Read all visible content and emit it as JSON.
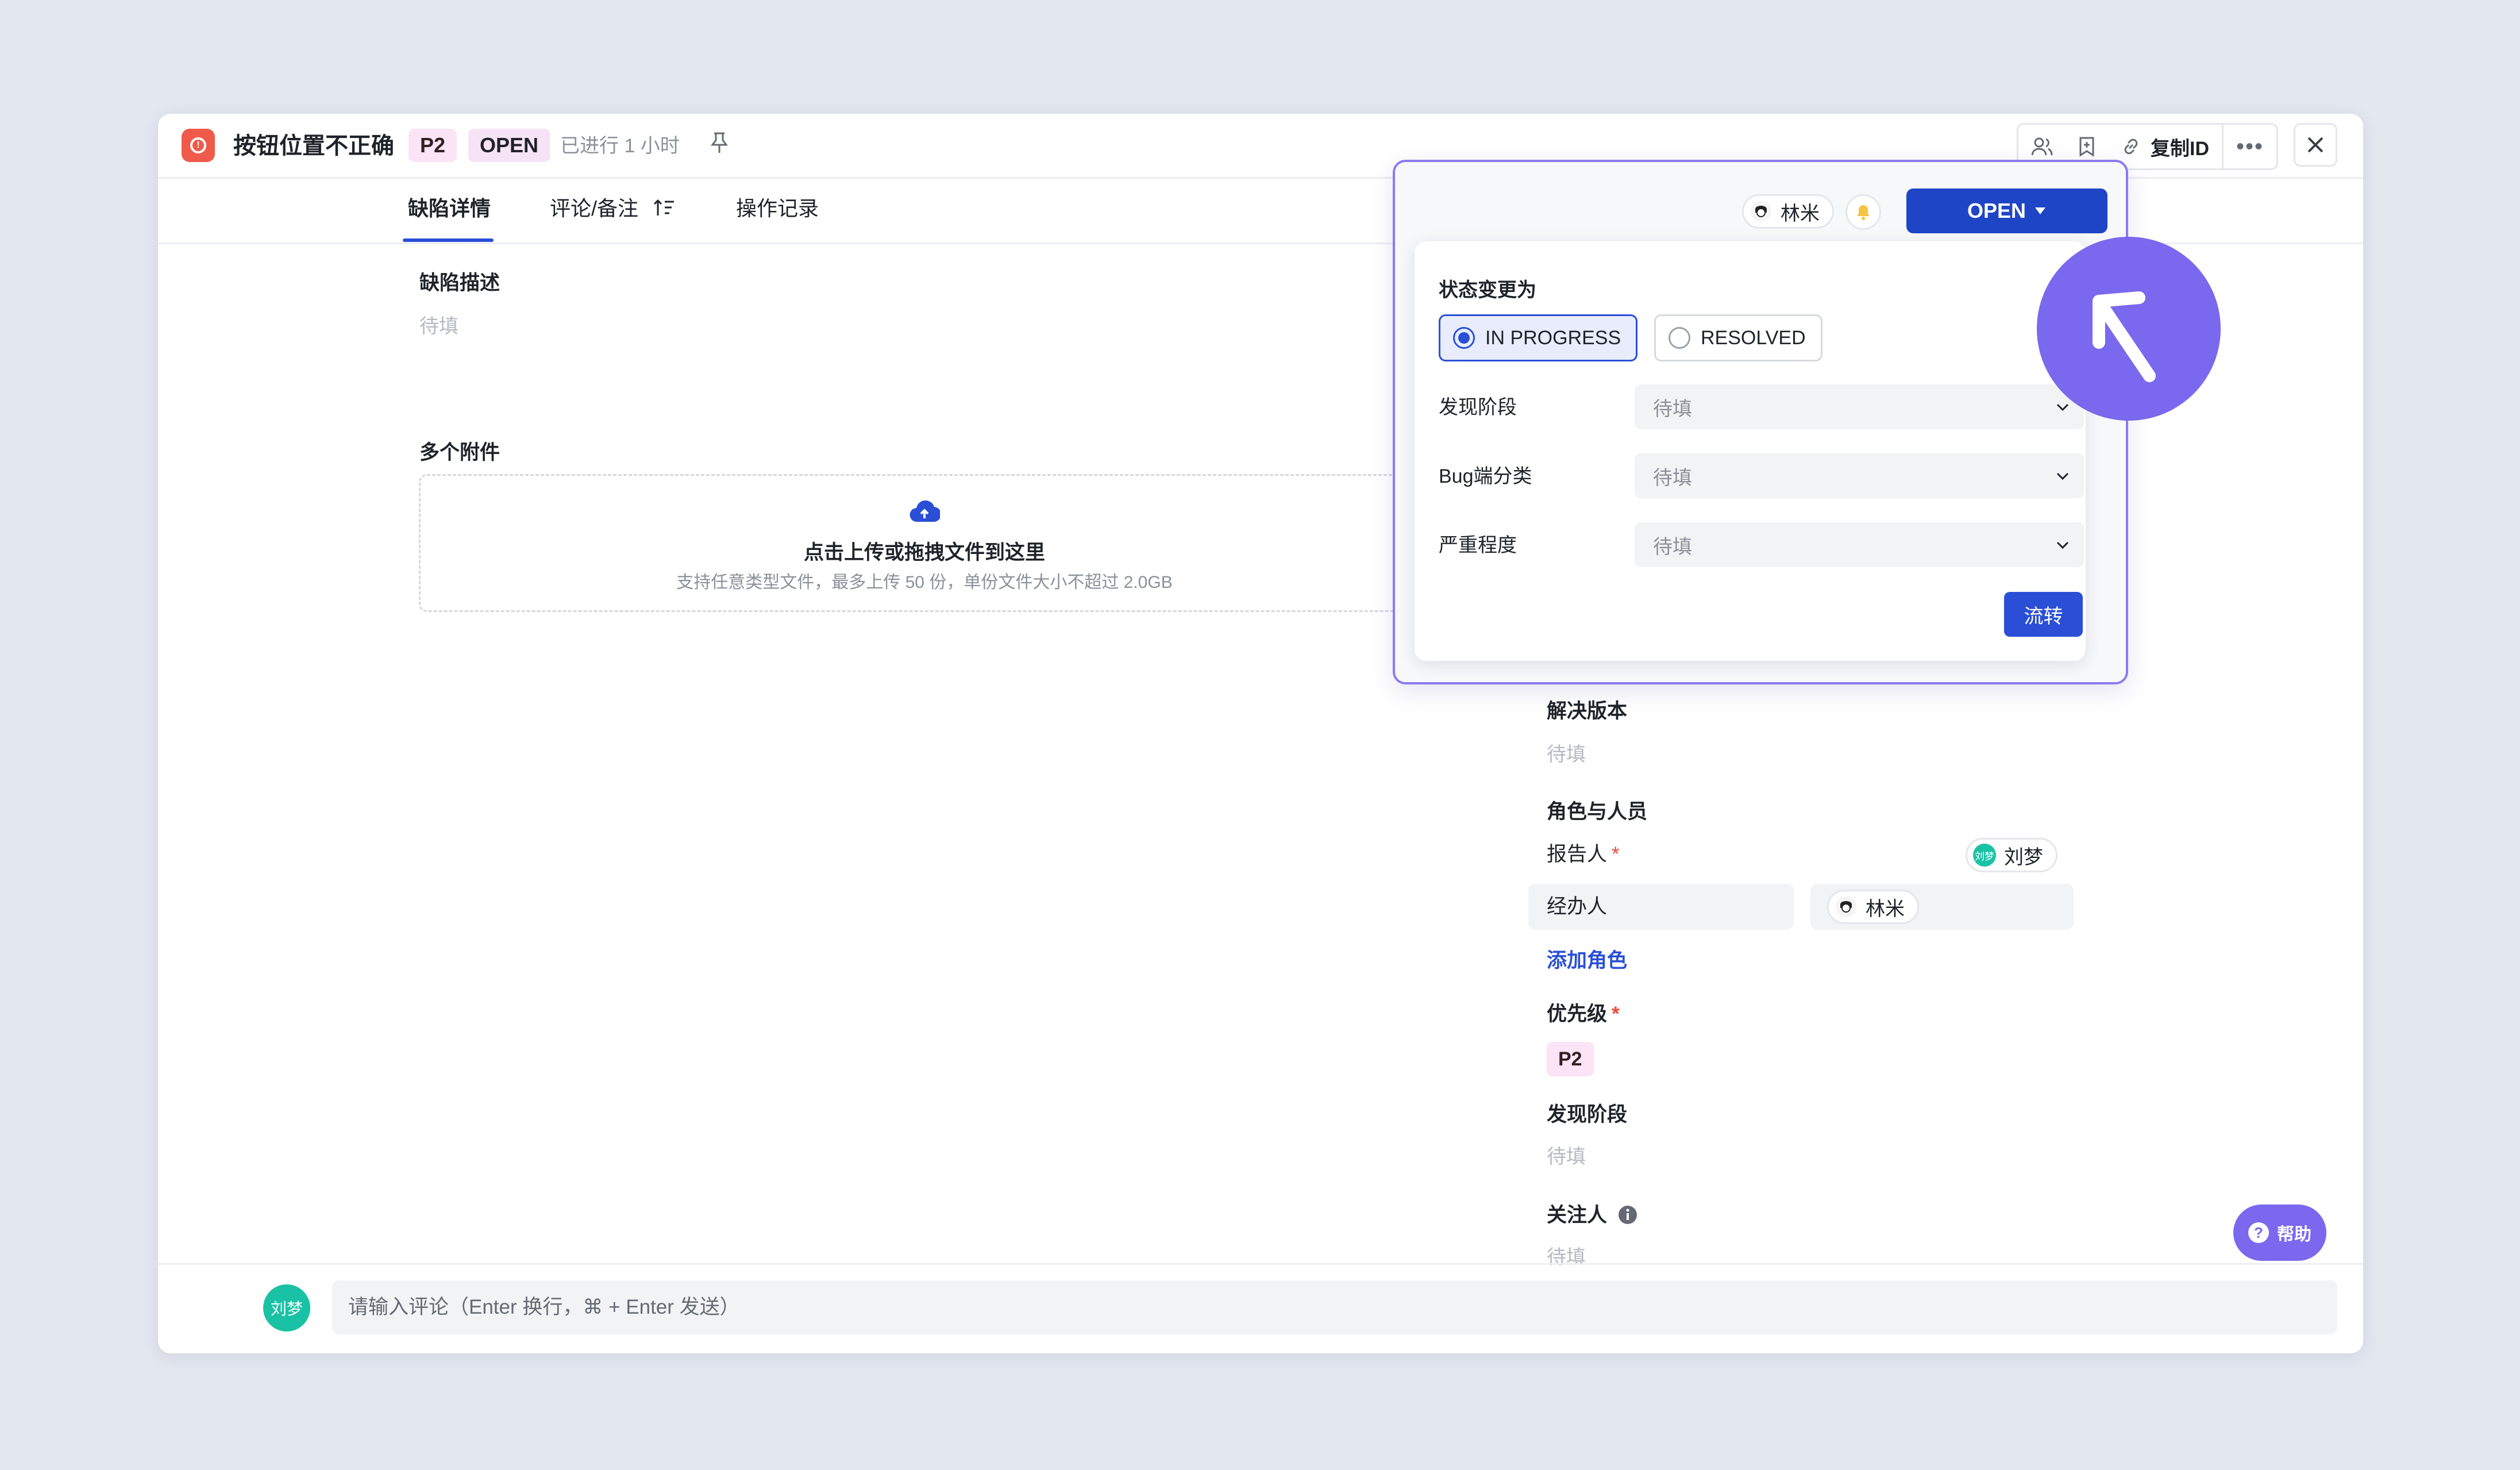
{
  "header": {
    "title": "按钮位置不正确",
    "priority_tag": "P2",
    "status_tag": "OPEN",
    "elapsed": "已进行 1 小时",
    "copy_id": "复制ID"
  },
  "tabs": [
    {
      "label": "缺陷详情"
    },
    {
      "label": "评论/备注"
    },
    {
      "label": "操作记录"
    }
  ],
  "main": {
    "description_label": "缺陷描述",
    "description_placeholder": "待填",
    "attachments_label": "多个附件",
    "upload_title": "点击上传或拖拽文件到这里",
    "upload_sub": "支持任意类型文件，最多上传 50 份，单份文件大小不超过 2.0GB"
  },
  "side": {
    "resolve_version_label": "解决版本",
    "resolve_version_value": "待填",
    "roles_label": "角色与人员",
    "reporter_label": "报告人",
    "reporter_name": "刘梦",
    "reporter_avatar": "刘梦",
    "assignee_label": "经办人",
    "assignee_name": "林米",
    "add_role": "添加角色",
    "priority_label": "优先级",
    "priority_value": "P2",
    "found_stage_label": "发现阶段",
    "found_stage_value": "待填",
    "followers_label": "关注人",
    "followers_value": "待填"
  },
  "popup": {
    "user_chip": "林米",
    "status_button": "OPEN",
    "change_to_label": "状态变更为",
    "options": [
      {
        "label": "IN PROGRESS",
        "selected": true
      },
      {
        "label": "RESOLVED",
        "selected": false
      }
    ],
    "fields": [
      {
        "label": "发现阶段",
        "value": "待填"
      },
      {
        "label": "Bug端分类",
        "value": "待填"
      },
      {
        "label": "严重程度",
        "value": "待填"
      }
    ],
    "submit": "流转"
  },
  "comment": {
    "avatar": "刘梦",
    "placeholder": "请输入评论（Enter 换行，⌘ + Enter 发送）"
  },
  "help": "帮助",
  "colors": {
    "accent": "#2a4fd6",
    "open_button": "#1f45c7",
    "highlight": "#7b68ee",
    "danger": "#f05a4a",
    "teal_avatar": "#19c2a4"
  }
}
